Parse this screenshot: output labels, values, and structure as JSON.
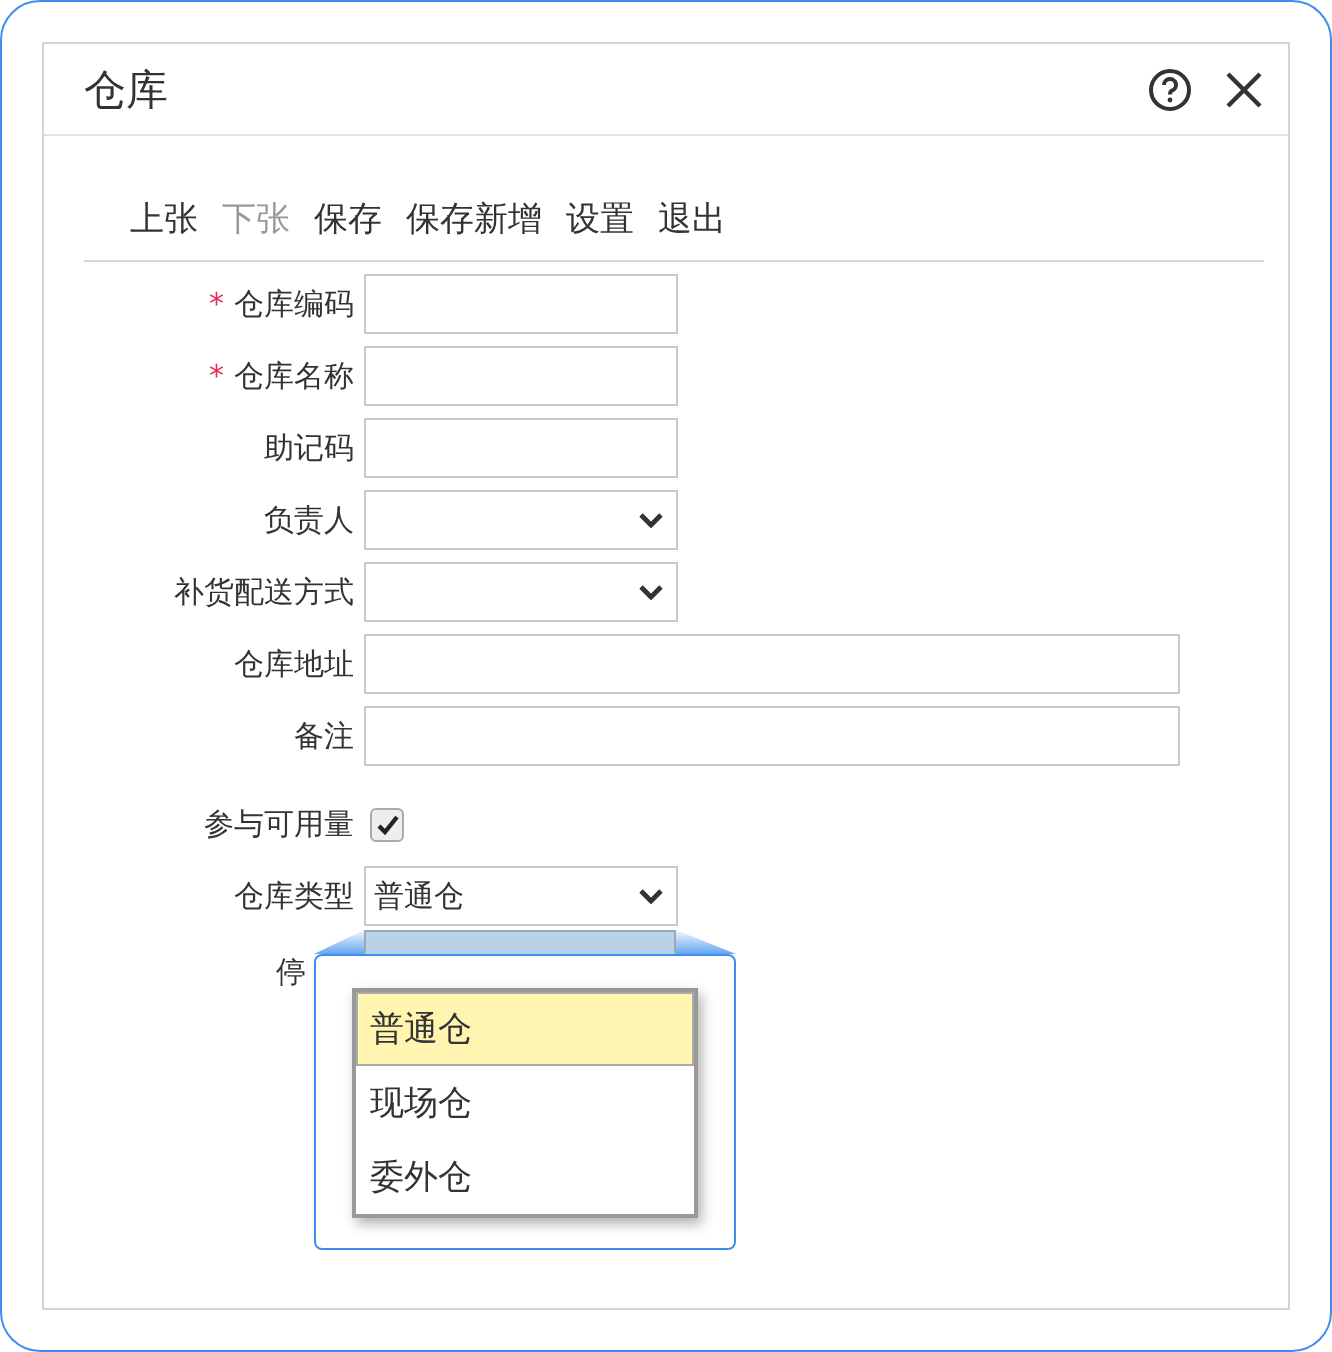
{
  "window": {
    "title": "仓库"
  },
  "toolbar": [
    {
      "label": "上张",
      "disabled": false
    },
    {
      "label": "下张",
      "disabled": true
    },
    {
      "label": "保存",
      "disabled": false
    },
    {
      "label": "保存新增",
      "disabled": false
    },
    {
      "label": "设置",
      "disabled": false
    },
    {
      "label": "退出",
      "disabled": false
    }
  ],
  "form": [
    {
      "label": "仓库编码",
      "kind": "text",
      "required_mark": "*",
      "wide": false
    },
    {
      "label": "仓库名称",
      "kind": "text",
      "required_mark": "*",
      "wide": false
    },
    {
      "label": "助记码",
      "kind": "text",
      "wide": false
    },
    {
      "label": "负责人",
      "kind": "select",
      "wide": false
    },
    {
      "label": "补货配送方式",
      "kind": "select",
      "wide": false
    },
    {
      "label": "仓库地址",
      "kind": "text",
      "wide": true
    },
    {
      "label": "备注",
      "kind": "text",
      "wide": true
    },
    {
      "label": "参与可用量",
      "kind": "checkbox",
      "checked": true
    },
    {
      "label": "仓库类型",
      "kind": "select",
      "wide": false,
      "value": "普通仓"
    },
    {
      "label": "停",
      "kind": "covered"
    }
  ],
  "dropdown_zoom": {
    "options": [
      {
        "label": "普通仓",
        "selected": true
      },
      {
        "label": "现场仓",
        "selected": false
      },
      {
        "label": "委外仓",
        "selected": false
      }
    ]
  }
}
